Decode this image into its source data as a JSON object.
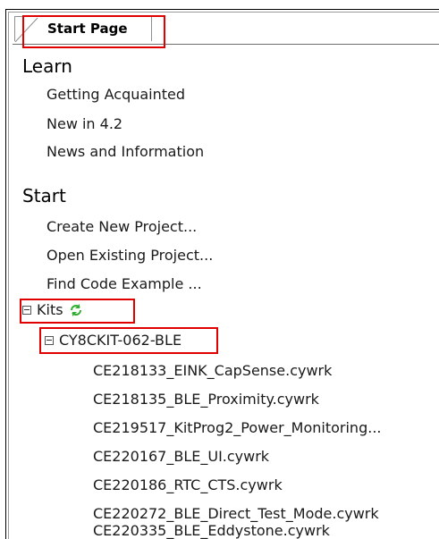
{
  "tab": {
    "label": "Start Page"
  },
  "learn": {
    "title": "Learn",
    "items": [
      "Getting Acquainted",
      "New in 4.2",
      "News and Information"
    ]
  },
  "start": {
    "title": "Start",
    "items": [
      "Create New Project...",
      "Open Existing Project...",
      "Find Code Example ..."
    ]
  },
  "kits": {
    "label": "Kits",
    "kit": {
      "name": "CY8CKIT-062-BLE",
      "examples": [
        "CE218133_EINK_CapSense.cywrk",
        "CE218135_BLE_Proximity.cywrk",
        "CE219517_KitProg2_Power_Monitoring...",
        "CE220167_BLE_UI.cywrk",
        "CE220186_RTC_CTS.cywrk",
        "CE220272_BLE_Direct_Test_Mode.cywrk",
        "CE220335_BLE_Eddystone.cywrk"
      ]
    }
  },
  "icons": {
    "refresh": "refresh-icon",
    "collapse": "minus-box-icon"
  },
  "colors": {
    "highlight": "#e00000",
    "refresh": "#2fae2f"
  }
}
